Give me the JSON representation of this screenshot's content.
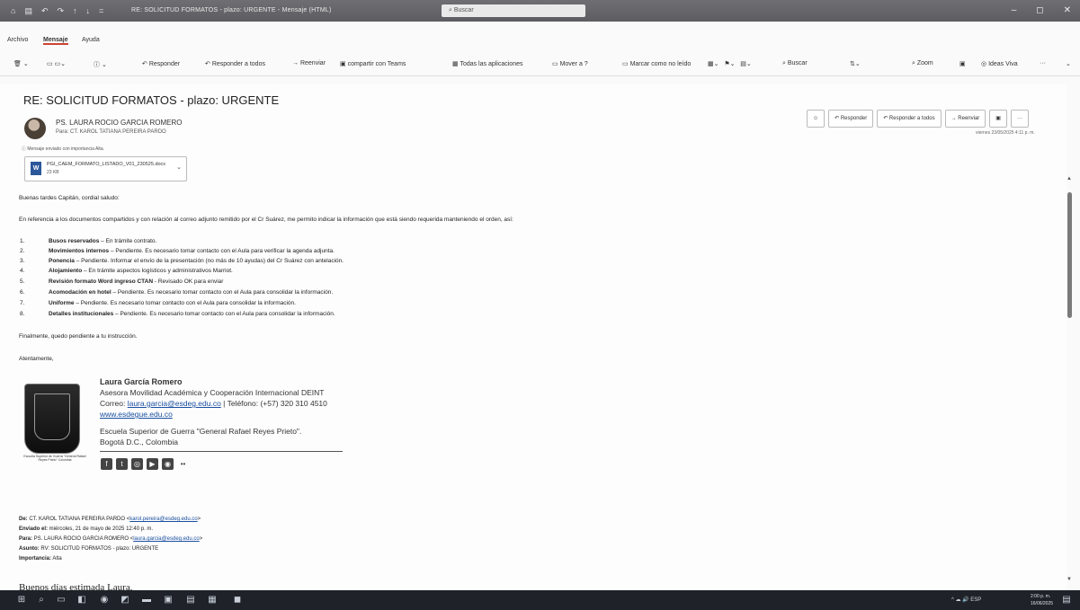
{
  "window": {
    "title": "RE: SOLICITUD FORMATOS - plazo: URGENTE  -  Mensaje (HTML)",
    "search_placeholder": "Buscar",
    "quick_icons": [
      "⌂",
      "▤",
      "↶",
      "↷",
      "↑",
      "↓",
      "="
    ],
    "controls": [
      "–",
      "◻",
      "✕"
    ]
  },
  "menu": {
    "items": [
      "Archivo",
      "Mensaje",
      "Ayuda"
    ]
  },
  "ribbon": {
    "items": [
      "Responder",
      "Responder a todos",
      "Reenviar",
      "compartir con Teams",
      "Todas las aplicaciones",
      "Mover a ?",
      "Marcar como no leído",
      "Buscar",
      "Zoom",
      "Ideas Viva",
      "···"
    ]
  },
  "message": {
    "subject": "RE: SOLICITUD FORMATOS - plazo: URGENTE",
    "sender": "PS. LAURA ROCIO GARCIA ROMERO",
    "to": "Para:   CT. KAROL TATIANA PEREIRA PARDO",
    "importance_note": "Mensaje enviado con importancia Alta.",
    "attachment": {
      "name": "PGI_CAEM_FORMATO_LISTADO_V01_230525.docx",
      "size": "23 KB"
    },
    "actions": [
      "Responder",
      "Responder a todos",
      "Reenviar",
      "···"
    ],
    "date": "viernes 23/05/2025 4:11 p. m."
  },
  "body": {
    "greeting": "Buenas tardes Capitán, cordial saludo:",
    "intro": "En referencia a los documentos compartidos y con relación al correo adjunto remitido por el Cr Suárez, me permito indicar la información que está siendo requerida manteniendo el orden, así:",
    "items": [
      {
        "num": "1.",
        "bold": "Busos reservados",
        "text": " – En trámite contrato."
      },
      {
        "num": "2.",
        "bold": "Movimientos internos",
        "text": " – Pendiente. Es necesario tomar contacto con el Aula para verificar la agenda adjunta."
      },
      {
        "num": "3.",
        "bold": "Ponencia",
        "text": " – Pendiente. Informar el envío de la presentación (no más de 10 ayudas) del Cr Suárez con antelación."
      },
      {
        "num": "4.",
        "bold": "Alojamiento",
        "text": " – En trámite aspectos logísticos y administrativos Marriot."
      },
      {
        "num": "5.",
        "bold": "Revisión formato Word ingreso CTAN",
        "text": " - Revisado OK para enviar"
      },
      {
        "num": "6.",
        "bold": "Acomodación en hotel",
        "text": " – Pendiente. Es necesario tomar contacto con el Aula para consolidar la información."
      },
      {
        "num": "7.",
        "bold": "Uniforme",
        "text": " – Pendiente. Es necesario tomar contacto con el Aula para consolidar la información."
      },
      {
        "num": "8.",
        "bold": "Detalles institucionales",
        "text": " – Pendiente. Es necesario tomar contacto con el Aula para consolidar la información."
      }
    ],
    "closing": "Finalmente, quedo pendiente a tu instrucción.",
    "regards": "Atentamente,"
  },
  "signature": {
    "name": "Laura García Romero",
    "role": "Asesora Movilidad Académica y Cooperación Internacional DEINT",
    "contact_prefix": "Correo: ",
    "email": "laura.garcia@esdeg.edu.co",
    "phone": " | Teléfono: (+57) 320 310 4510",
    "website": "www.esdegue.edu.co",
    "org": "Escuela Superior de Guerra \"General Rafael Reyes Prieto\".",
    "city": "Bogotá D.C., Colombia",
    "crest_caption": "Escuela Superior de Guerra \"General Rafael Reyes Prieto\" Colombia",
    "social_icons": [
      "f",
      "t",
      "◎",
      "▶",
      "◉",
      "••"
    ]
  },
  "quoted": {
    "from_label": "De:",
    "from": " CT. KAROL TATIANA PEREIRA PARDO <",
    "from_email": "karol.pereira@esdeg.edu.co",
    "sent_label": "Enviado el:",
    "sent": " miércoles, 21 de mayo de 2025 12:40 p. m.",
    "to_label": "Para:",
    "to": " PS. LAURA ROCIO GARCIA ROMERO <",
    "to_email": "laura.garcia@esdeg.edu.co",
    "subject_label": "Asunto:",
    "subject": " RV: SOLICITUD FORMATOS - plazo: URGENTE",
    "importance_label": "Importancia:",
    "importance": " Alta",
    "greeting": "Buenos días estimada Laura,"
  },
  "taskbar": {
    "tray": "^  ☁  🔊  ESP",
    "time": "2:00 p. m.",
    "date": "16/06/2025"
  }
}
